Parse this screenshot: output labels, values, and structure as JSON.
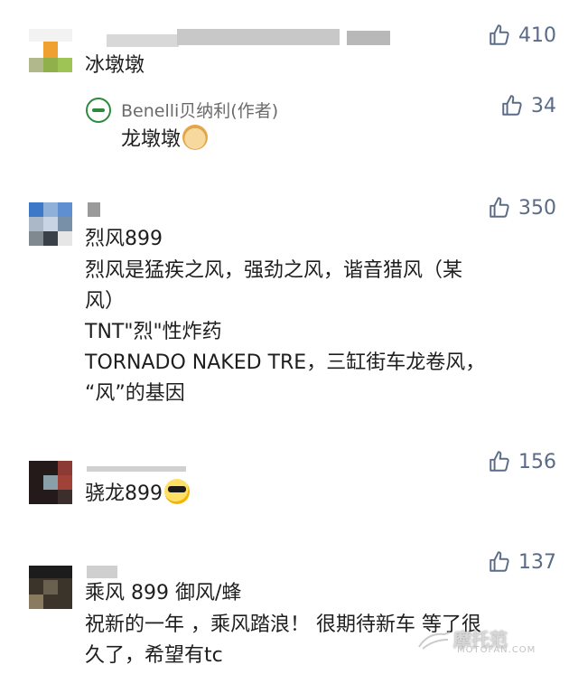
{
  "comments": [
    {
      "likes": "410",
      "text": "冰墩墩",
      "reply": {
        "author": "Benelli贝纳利(作者)",
        "likes": "34",
        "text": "龙墩墩"
      }
    },
    {
      "likes": "350",
      "lines": [
        "烈风899",
        "烈风是猛疾之风，强劲之风，谐音猎风（某",
        "风）",
        "TNT\"烈\"性炸药",
        "TORNADO NAKED TRE，三缸街车龙卷风，",
        "“风”的基因"
      ]
    },
    {
      "likes": "156",
      "text": "骁龙899"
    },
    {
      "likes": "137",
      "lines": [
        "乘风 899  御风/蜂",
        "祝新的一年 ，乘风踏浪！ 很期待新车 等了很",
        "久了，希望有tc"
      ]
    }
  ],
  "watermark": {
    "line1": "摩托范",
    "line2": "MOTOFAN.COM"
  },
  "icons": {
    "like": "thumbs-up-icon",
    "emoji_doge": "doge-emoji-icon",
    "emoji_cool": "sunglasses-emoji-icon"
  }
}
